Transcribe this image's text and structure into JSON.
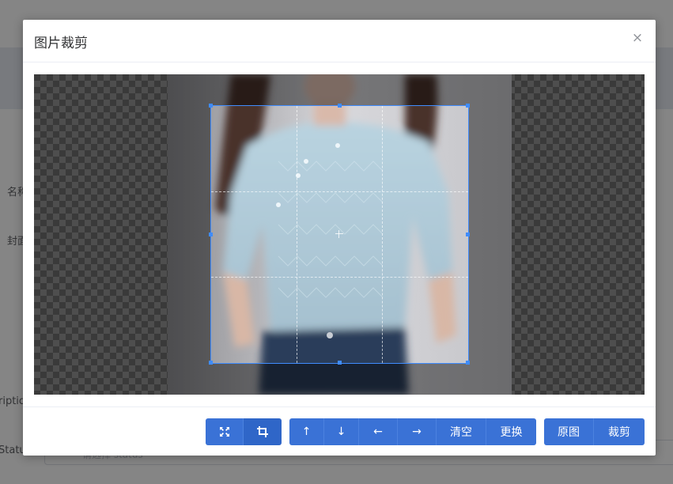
{
  "dialog": {
    "title": "图片裁剪",
    "close_glyph": "×"
  },
  "background": {
    "labels": [
      "名称",
      "封面",
      "ription",
      "Status"
    ],
    "input_placeholder": "请选择 status"
  },
  "cropper": {
    "handle_color": "#3f8cff"
  },
  "toolbar": {
    "group1": [
      {
        "name": "fit-icon",
        "icon": "fit-icon"
      },
      {
        "name": "crop-icon",
        "icon": "crop-icon"
      }
    ],
    "group2": [
      {
        "name": "move-up-button",
        "label": "↑"
      },
      {
        "name": "move-down-button",
        "label": "↓"
      },
      {
        "name": "move-left-button",
        "label": "←"
      },
      {
        "name": "move-right-button",
        "label": "→"
      },
      {
        "name": "clear-button",
        "label": "清空"
      },
      {
        "name": "replace-button",
        "label": "更换"
      }
    ],
    "group3": [
      {
        "name": "original-button",
        "label": "原图"
      },
      {
        "name": "crop-button",
        "label": "裁剪"
      }
    ],
    "accent_color": "#3a72d6"
  }
}
